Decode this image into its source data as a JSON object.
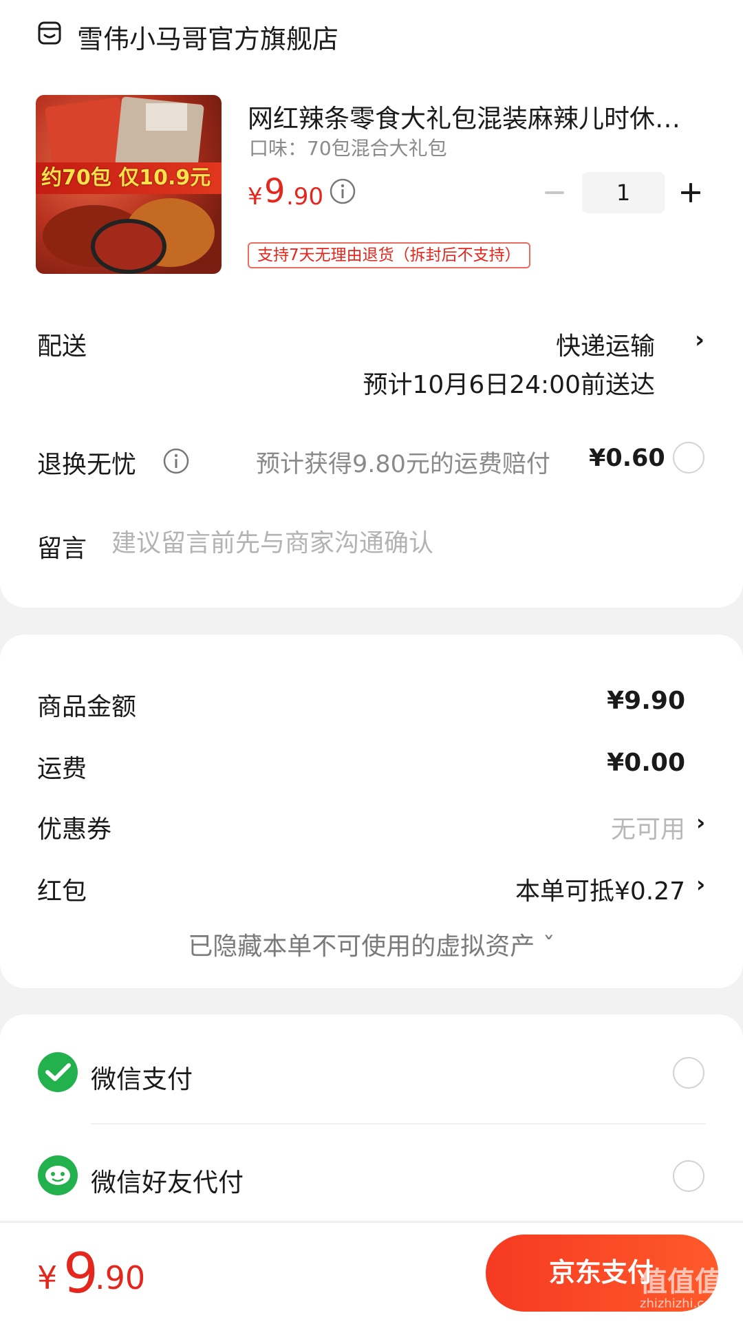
{
  "store": {
    "name": "雪伟小马哥官方旗舰店",
    "icon": "store-icon"
  },
  "product": {
    "title": "网红辣条零食大礼包混装麻辣儿时休…",
    "spec": "口味：70包混合大礼包",
    "price_symbol": "¥",
    "price_int": "9",
    "price_dec": ".90",
    "quantity": "1",
    "return_policy": "支持7天无理由退货（拆封后不支持）",
    "image_banner": "约70包 仅10.9元"
  },
  "delivery": {
    "label": "配送",
    "method": "快递运输",
    "eta": "预计10月6日24:00前送达"
  },
  "worry_free": {
    "label": "退换无忧",
    "desc": "预计获得9.80元的运费赔付",
    "price": "¥0.60"
  },
  "message": {
    "label": "留言",
    "placeholder": "建议留言前先与商家沟通确认"
  },
  "summary": {
    "goods_label": "商品金额",
    "goods_value": "¥9.90",
    "shipping_label": "运费",
    "shipping_value": "¥0.00",
    "coupon_label": "优惠券",
    "coupon_value": "无可用",
    "redpacket_label": "红包",
    "redpacket_value": "本单可抵¥0.27",
    "hidden_assets": "已隐藏本单不可使用的虚拟资产 ˇ"
  },
  "payment_methods": [
    {
      "label": "微信支付",
      "icon": "wechat-pay-icon"
    },
    {
      "label": "微信好友代付",
      "icon": "wechat-friend-pay-icon"
    }
  ],
  "footer": {
    "total_symbol": "¥",
    "total_int": "9",
    "total_dec": ".90",
    "pay_button": "京东支付",
    "watermark": "值值值",
    "watermark_url": "zhizhizhi.com"
  },
  "colors": {
    "accent": "#e4261c",
    "wechat_green": "#22b14c"
  }
}
